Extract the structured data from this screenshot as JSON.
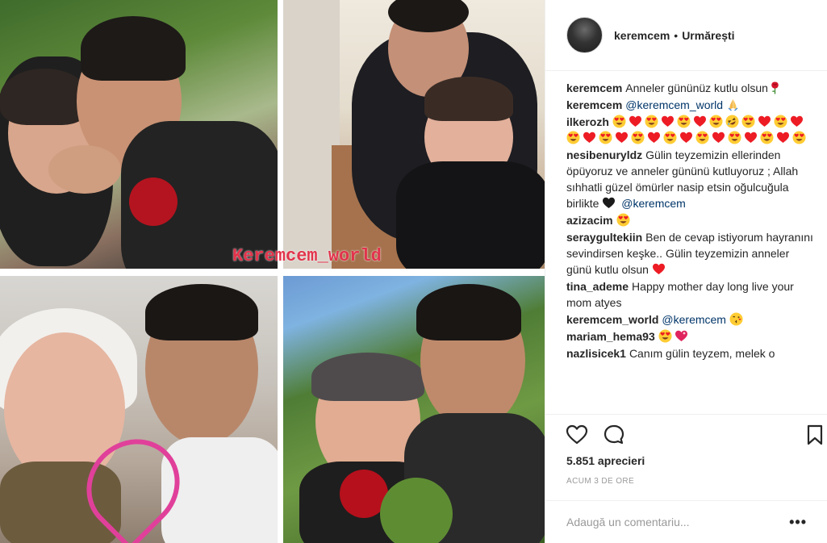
{
  "post": {
    "username": "keremcem",
    "separator": "•",
    "follow_label": "Urmărești",
    "watermark": "Keremcem_world",
    "likes": "5.851 aprecieri",
    "timestamp": "ACUM 3 DE ORE",
    "comment_placeholder": "Adaugă un comentariu...",
    "more_label": "•••"
  },
  "comments": [
    {
      "user": "keremcem",
      "parts": [
        {
          "t": "Anneler gününüz kutlu olsun"
        },
        {
          "e": "rose"
        }
      ]
    },
    {
      "user": "keremcem",
      "parts": [
        {
          "m": "@keremcem_world"
        },
        {
          "t": " "
        },
        {
          "e": "pray"
        }
      ]
    },
    {
      "user": "ilkerozh",
      "parts": [
        {
          "e": "heart-eyes"
        },
        {
          "e": "heart"
        },
        {
          "e": "heart-eyes"
        },
        {
          "e": "heart"
        },
        {
          "e": "heart-eyes"
        },
        {
          "e": "heart"
        },
        {
          "e": "heart-eyes"
        },
        {
          "e": "rofl"
        },
        {
          "e": "heart-eyes"
        },
        {
          "e": "heart"
        },
        {
          "e": "heart-eyes"
        },
        {
          "e": "heart"
        },
        {
          "e": "heart-eyes"
        },
        {
          "e": "heart"
        },
        {
          "e": "heart-eyes"
        },
        {
          "e": "heart"
        },
        {
          "e": "heart-eyes"
        },
        {
          "e": "heart"
        },
        {
          "e": "heart-eyes"
        },
        {
          "e": "heart"
        },
        {
          "e": "heart-eyes"
        },
        {
          "e": "heart"
        },
        {
          "e": "heart-eyes"
        },
        {
          "e": "heart"
        },
        {
          "e": "heart-eyes"
        },
        {
          "e": "heart"
        },
        {
          "e": "heart-eyes"
        }
      ]
    },
    {
      "user": "nesibenuryldz",
      "parts": [
        {
          "t": "Gülin teyzemizin ellerinden öpüyoruz ve anneler gününü kutluyoruz ; Allah sıhhatli güzel ömürler nasip etsin oğulcuğula birlikte "
        },
        {
          "e": "black-heart"
        },
        {
          "t": " "
        },
        {
          "m": "@keremcem"
        }
      ]
    },
    {
      "user": "azizacim",
      "parts": [
        {
          "e": "heart-eyes"
        }
      ]
    },
    {
      "user": "seraygultekiin",
      "parts": [
        {
          "t": "Ben de cevap istiyorum hayranını sevindirsen keşke.. Gülin teyzemizin anneler günü kutlu olsun "
        },
        {
          "e": "heart"
        }
      ]
    },
    {
      "user": "tina_ademe",
      "parts": [
        {
          "t": "Happy mother day long live your mom atyes"
        }
      ]
    },
    {
      "user": "keremcem_world",
      "parts": [
        {
          "m": "@keremcem"
        },
        {
          "t": " "
        },
        {
          "e": "kiss"
        }
      ]
    },
    {
      "user": "mariam_hema93",
      "parts": [
        {
          "e": "heart-eyes"
        },
        {
          "e": "sparkle-heart"
        }
      ]
    },
    {
      "user": "nazlisicek1",
      "parts": [
        {
          "t": "Canım gülin teyzem, melek o"
        }
      ]
    }
  ],
  "colors": {
    "text": "#262626",
    "mention": "#003569",
    "muted": "#999999",
    "heart": "#ed1c24",
    "emoji_face": "#ffcc33"
  }
}
